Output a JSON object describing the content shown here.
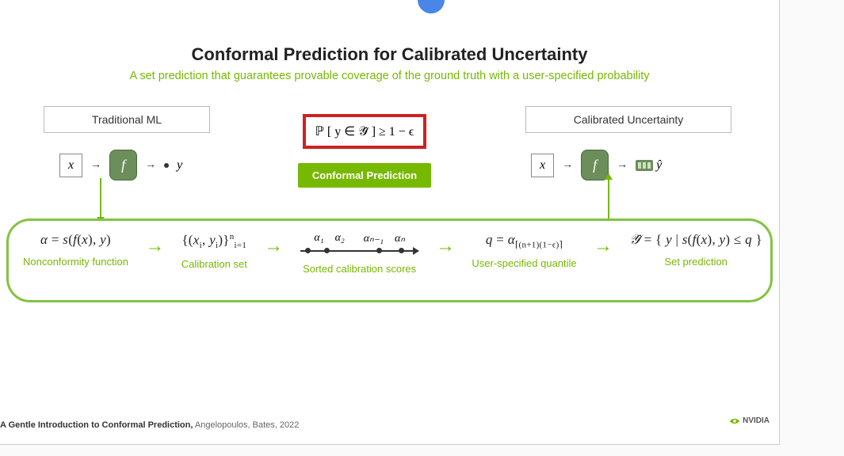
{
  "header": {
    "title": "Conformal Prediction for Calibrated Uncertainty",
    "subtitle": "A set prediction that guarantees provable coverage of the ground truth with a user-specified probability"
  },
  "left_pipe": {
    "box_label": "Traditional ML",
    "input": "x",
    "func": "f",
    "output": "y"
  },
  "right_pipe": {
    "box_label": "Calibrated Uncertainty",
    "input": "x",
    "func": "f",
    "output": "ŷ"
  },
  "center": {
    "prob_expr": "ℙ [ y ∈ 𝒴̂ ] ≥ 1 − ϵ",
    "button": "Conformal Prediction"
  },
  "steps": {
    "nonconf": {
      "expr": "α = s(f(x), y)",
      "label": "Nonconformity function"
    },
    "calib": {
      "expr": "{(xᵢ, yᵢ)}ⁿᵢ₌₁",
      "label": "Calibration set"
    },
    "sorted": {
      "alphas": [
        "α₁",
        "α₂",
        "αₙ₋₁",
        "αₙ"
      ],
      "label": "Sorted calibration scores"
    },
    "quantile": {
      "expr": "q = α⌈(n+1)(1−ϵ)⌉",
      "label": "User-specified quantile"
    },
    "setpred": {
      "expr": "𝒴̂ = { y | s(f(x), y) ≤ q }",
      "label": "Set prediction"
    }
  },
  "footer": {
    "bold": "A Gentle Introduction to Conformal Prediction,",
    "rest": " Angelopoulos, Bates, 2022"
  },
  "brand": "NVIDIA"
}
